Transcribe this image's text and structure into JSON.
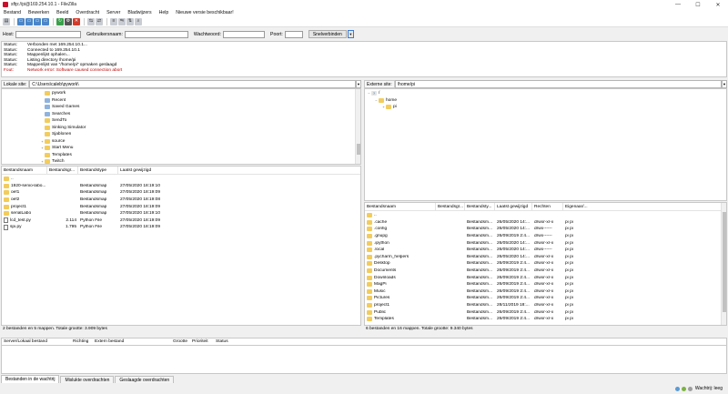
{
  "window": {
    "title": "sftp://pi@169.254.10.1 - FileZilla",
    "minimize": "—",
    "maximize": "☐",
    "close": "✕"
  },
  "menu": [
    "Bestand",
    "Bewerken",
    "Beeld",
    "Overdracht",
    "Server",
    "Bladwijzers",
    "Help",
    "Nieuwe versie beschikbaar!"
  ],
  "quickconnect": {
    "host_label": "Host:",
    "user_label": "Gebruikersnaam:",
    "password_label": "Wachtwoord:",
    "port_label": "Poort:",
    "host_value": "",
    "user_value": "",
    "password_value": "",
    "port_value": "",
    "button": "Snelverbinden"
  },
  "log": [
    {
      "label": "Status:",
      "text": "Verbonden met 169.254.10.1...",
      "type": "status"
    },
    {
      "label": "Status:",
      "text": "Connected to 169.254.10.1",
      "type": "status"
    },
    {
      "label": "Status:",
      "text": "Mappenlijst ophalen...",
      "type": "status"
    },
    {
      "label": "Status:",
      "text": "Listing directory /home/pi",
      "type": "status"
    },
    {
      "label": "Status:",
      "text": "Mappenlijst van \"/home/pi\" opmaken geslaagd",
      "type": "status"
    },
    {
      "label": "Fout:",
      "text": "Network error: Software caused connection abort",
      "type": "error"
    }
  ],
  "local": {
    "path_label": "Lokale site:",
    "path_value": "C:\\Users\\caleb\\pywork\\",
    "tree": [
      {
        "name": "pywork",
        "icon": "folder",
        "expand": ""
      },
      {
        "name": "Recent",
        "icon": "special-folder",
        "expand": ""
      },
      {
        "name": "Saved Games",
        "icon": "special-folder",
        "expand": ""
      },
      {
        "name": "Searches",
        "icon": "special-folder",
        "expand": ""
      },
      {
        "name": "SendTo",
        "icon": "folder",
        "expand": ""
      },
      {
        "name": "Sinking Simulator",
        "icon": "folder",
        "expand": ""
      },
      {
        "name": "Sjablonen",
        "icon": "folder",
        "expand": ""
      },
      {
        "name": "source",
        "icon": "folder",
        "expand": "+"
      },
      {
        "name": "Start Menu",
        "icon": "folder",
        "expand": "+"
      },
      {
        "name": "Templates",
        "icon": "folder",
        "expand": ""
      },
      {
        "name": "Twitch",
        "icon": "folder",
        "expand": "+"
      }
    ],
    "columns": [
      "Bestandsnaam",
      "Bestandsgr...",
      "Bestandstype",
      "Laatst gewijzigd"
    ],
    "files": [
      {
        "name": "..",
        "size": "",
        "type": "",
        "modified": "",
        "icon": "folder"
      },
      {
        "name": "1920-senio-labo...",
        "size": "",
        "type": "Bestandsmap",
        "modified": "27/05/2020 18:19:10",
        "icon": "folder"
      },
      {
        "name": "oef1",
        "size": "",
        "type": "Bestandsmap",
        "modified": "27/05/2020 18:19:09",
        "icon": "folder"
      },
      {
        "name": "oef2",
        "size": "",
        "type": "Bestandsmap",
        "modified": "27/05/2020 18:19:08",
        "icon": "folder"
      },
      {
        "name": "project1",
        "size": "",
        "type": "Bestandsmap",
        "modified": "27/05/2020 18:19:09",
        "icon": "folder"
      },
      {
        "name": "serialLabo",
        "size": "",
        "type": "Bestandsmap",
        "modified": "27/05/2020 18:19:10",
        "icon": "folder"
      },
      {
        "name": "lcd_test.py",
        "size": "2.114",
        "type": "Python File",
        "modified": "27/05/2020 18:19:09",
        "icon": "doc"
      },
      {
        "name": "spi.py",
        "size": "1.795",
        "type": "Python File",
        "modified": "27/05/2020 18:19:09",
        "icon": "doc"
      }
    ],
    "status": "2 bestanden en 5 mappen. Totale grootte: 3.909 bytes"
  },
  "remote": {
    "path_label": "Externe site:",
    "path_value": "/home/pi",
    "tree": [
      {
        "name": "/",
        "icon": "unknown",
        "expand": "−",
        "indent": 0
      },
      {
        "name": "home",
        "icon": "folder",
        "expand": "−",
        "indent": 1
      },
      {
        "name": "pi",
        "icon": "folder",
        "expand": "+",
        "indent": 2
      }
    ],
    "columns": [
      "Bestandsnaam",
      "Bestandsgr...",
      "Bestandsty...",
      "Laatst gewijzigd",
      "Rechten",
      "Eigenaar/..."
    ],
    "files": [
      {
        "name": "..",
        "size": "",
        "type": "",
        "modified": "",
        "perms": "",
        "owner": ""
      },
      {
        "name": ".cache",
        "size": "",
        "type": "Bestandsm...",
        "modified": "26/05/2020 14:...",
        "perms": "drwxr-xr-x",
        "owner": "pi pi"
      },
      {
        "name": ".config",
        "size": "",
        "type": "Bestandsm...",
        "modified": "26/05/2020 14:...",
        "perms": "drwx------",
        "owner": "pi pi"
      },
      {
        "name": ".gnupg",
        "size": "",
        "type": "Bestandsm...",
        "modified": "26/09/2019 2:4...",
        "perms": "drwx------",
        "owner": "pi pi"
      },
      {
        "name": ".ipython",
        "size": "",
        "type": "Bestandsm...",
        "modified": "26/05/2020 14:...",
        "perms": "drwxr-xr-x",
        "owner": "pi pi"
      },
      {
        "name": ".local",
        "size": "",
        "type": "Bestandsm...",
        "modified": "26/05/2020 14:...",
        "perms": "drwx------",
        "owner": "pi pi"
      },
      {
        "name": ".pycharm_helpers",
        "size": "",
        "type": "Bestandsm...",
        "modified": "26/05/2020 14:...",
        "perms": "drwxr-xr-x",
        "owner": "pi pi"
      },
      {
        "name": "Desktop",
        "size": "",
        "type": "Bestandsm...",
        "modified": "26/09/2019 2:4...",
        "perms": "drwxr-xr-x",
        "owner": "pi pi"
      },
      {
        "name": "Documents",
        "size": "",
        "type": "Bestandsm...",
        "modified": "26/09/2019 2:4...",
        "perms": "drwxr-xr-x",
        "owner": "pi pi"
      },
      {
        "name": "Downloads",
        "size": "",
        "type": "Bestandsm...",
        "modified": "26/09/2019 2:4...",
        "perms": "drwxr-xr-x",
        "owner": "pi pi"
      },
      {
        "name": "MagPi",
        "size": "",
        "type": "Bestandsm...",
        "modified": "26/09/2019 2:4...",
        "perms": "drwxr-xr-x",
        "owner": "pi pi"
      },
      {
        "name": "Music",
        "size": "",
        "type": "Bestandsm...",
        "modified": "26/09/2019 2:4...",
        "perms": "drwxr-xr-x",
        "owner": "pi pi"
      },
      {
        "name": "Pictures",
        "size": "",
        "type": "Bestandsm...",
        "modified": "26/09/2019 2:4...",
        "perms": "drwxr-xr-x",
        "owner": "pi pi"
      },
      {
        "name": "project1",
        "size": "",
        "type": "Bestandsm...",
        "modified": "28/11/2019 18:...",
        "perms": "drwxr-xr-x",
        "owner": "pi pi"
      },
      {
        "name": "Public",
        "size": "",
        "type": "Bestandsm...",
        "modified": "26/09/2019 2:4...",
        "perms": "drwxr-xr-x",
        "owner": "pi pi"
      },
      {
        "name": "Templates",
        "size": "",
        "type": "Bestandsm...",
        "modified": "26/09/2019 2:4...",
        "perms": "drwxr-xr-x",
        "owner": "pi pi"
      }
    ],
    "status": "6 bestanden en 16 mappen. Totale grootte: 9.340 bytes"
  },
  "queue": {
    "columns": [
      "Server/Lokaal bestand",
      "Richting",
      "Extern bestand",
      "Grootte",
      "Prioriteit",
      "Status"
    ],
    "tabs": [
      "Bestanden in de wachtrij",
      "Mislukte overdrachten",
      "Geslaagde overdrachten"
    ]
  },
  "statusbar": {
    "text": "Wachtrij: leeg"
  },
  "colors": {
    "folder": "#f2cc5c",
    "error": "#c00000",
    "accent": "#3a7bd5"
  }
}
